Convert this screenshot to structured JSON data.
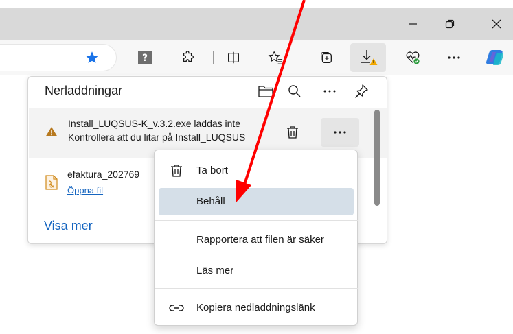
{
  "window": {
    "minimize_icon": "minimize-icon",
    "restore_icon": "restore-icon",
    "close_icon": "close-icon"
  },
  "toolbar": {
    "icons": [
      "favorite-star-icon",
      "extension-puzzle-icon",
      "extensions-icon",
      "split-screen-icon",
      "favorites-icon",
      "collections-icon",
      "downloads-icon",
      "browser-essentials-icon",
      "more-icon",
      "copilot-icon"
    ],
    "accent_color": "#1a73e8"
  },
  "downloads_panel": {
    "title": "Nerladdningar",
    "items": [
      {
        "line1": "Install_LUQSUS-K_v.3.2.exe laddas inte",
        "line2": "Kontrollera att du litar på Install_LUQSUS",
        "status_icon": "warning-icon"
      },
      {
        "name": "efaktura_202769",
        "action": "Öppna fil",
        "file_icon": "pdf-file-icon"
      }
    ],
    "show_more": "Visa mer"
  },
  "context_menu": {
    "items": [
      {
        "label": "Ta bort",
        "icon": "trash-icon"
      },
      {
        "label": "Behåll",
        "icon": ""
      },
      {
        "label": "Rapportera att filen är säker",
        "icon": ""
      },
      {
        "label": "Läs mer",
        "icon": ""
      },
      {
        "label": "Kopiera nedladdningslänk",
        "icon": "link-icon"
      }
    ],
    "highlight_color": "#d5dfe8"
  },
  "annotation": {
    "arrow_color": "#ff0000"
  }
}
